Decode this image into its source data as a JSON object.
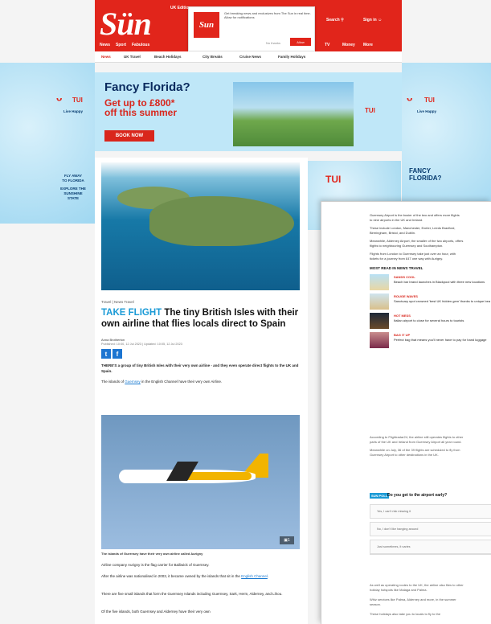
{
  "header": {
    "logo": "Sün",
    "logo_sub": "UK Edition",
    "search": "Search",
    "sign_in": "Sign in",
    "nav": [
      "News",
      "Sport",
      "Fabulous",
      "TV",
      "Money",
      "More"
    ],
    "subnav": [
      "News",
      "UK Travel",
      "Beach Holidays",
      "City Breaks",
      "Cruise News",
      "Family Holidays"
    ]
  },
  "notification": {
    "logo": "Sun",
    "message": "Get breaking news and exclusives from The Sun in real time. Allow for notifications",
    "later": "No thanks",
    "allow": "Allow"
  },
  "left_skin": {
    "brand": "TUI",
    "tagline": "Live Happy",
    "cta_lines": [
      "FLY AWAY",
      "TO FLORIDA",
      "EXPLORE THE",
      "SUNSHINE",
      "STATE"
    ]
  },
  "right_skin": {
    "brand": "TUI",
    "tagline": "Live Happy"
  },
  "banner": {
    "headline": "Fancy Florida?",
    "offer_line1": "Get up to £800*",
    "offer_line2": "off this summer",
    "button": "BOOK NOW",
    "brand": "TUI"
  },
  "ad_right": {
    "brand": "TUI",
    "headline_line1": "FANCY",
    "headline_line2": "FLORIDA?"
  },
  "article": {
    "breadcrumb": "Travel | News Travel",
    "kicker": "TAKE FLIGHT",
    "headline": "The tiny British Isles with their own airline that flies locals direct to Spain",
    "author": "Anna Brotherton",
    "published": "Published: 10:00, 12 Jul 2023 | Updated: 10:05, 12 Jul 2023",
    "share_twitter": "t",
    "share_facebook": "f",
    "intro": "THERE'S a group of tiny British Isles with their very own airline - and they even operate direct flights to the UK and Spain.",
    "p1_a": "The islands of ",
    "p1_link": "Guernsey",
    "p1_b": " in the English Channel have their very own Airline.",
    "photo_caption": "The islands of Guernsey have their very own airline called Aurigny",
    "photo_icon": "1",
    "p2": "Airline company Aurigny is the flag carrier for Bailiwick of Guernsey.",
    "p3_a": "After the airline was nationalised in 2003, it became owned by the islands that sit in the ",
    "p3_link": "English Channel",
    "p3_b": ".",
    "p4": "There are five small islands that form the Guernsey Islands including Guernsey, Sark, Herm, Alderney, and Lihou.",
    "p5": "Of the five islands, both Guernsey and Alderney have their very own"
  },
  "side_panel": {
    "lines": [
      "Guernsey Airport is the busier of the two and offers more flights",
      "to nine airports in the UK and Ireland.",
      "These include London, Manchester, Exeter, Leeds Bradford,",
      "Birmingham, Bristol, and Dublin.",
      "Meanwhile, Alderney Airport, the smaller of the two airports, offers",
      "flights to neighbouring Guernsey and Southampton.",
      "Flights from London to Guernsey take just over an hour, with",
      "tickets for a journey from £47 one way with Aurigny."
    ],
    "most_read_title": "MOST READ IN NEWS TRAVEL",
    "most_read": [
      {
        "kicker": "SANDS COOL",
        "text": "Beach bar brand launches in Blackpool with three new locations"
      },
      {
        "kicker": "ROUGE WAVES",
        "text": "Sanctuary spot crowned 'best UK hidden gem' thanks to unique beach"
      },
      {
        "kicker": "HOT MESS",
        "text": "Italian airport to close for several hours to tourists"
      },
      {
        "kicker": "BAG IT UP",
        "text": "Perfect bag that means you'll never have to pay for hand luggage"
      }
    ],
    "p_after_1": "According to Flightradar24, the airline still operates flights to other",
    "p_after_2": "parts of the UK and Ireland from Guernsey Airport all year round.",
    "p_after_3": "Meanwhile on July, 36 of the 39 flights are scheduled to fly from",
    "p_after_4": "Guernsey Airport to other destinations in the UK.",
    "poll_tag": "SUN POLL",
    "poll_question": "Do you get to the airport early?",
    "poll_options": [
      "Yes, I can't risk missing it",
      "No, I don't like hanging around",
      "Just sometimes, it varies"
    ],
    "bottom_1": "As well as operating routes to the UK, the airline also flies to other",
    "bottom_2": "holiday hotspots like Malaga and Palma.",
    "bottom_3": "Whiz services like Palma, Alderney and more, in the summer",
    "bottom_4": "season.",
    "bottom_5": "These holidays also take you to locals to fly to the"
  },
  "colors": {
    "brand_red": "#e1251b",
    "link_blue": "#1a7ad0",
    "kicker_blue": "#1a9ad6",
    "tui_navy": "#0a2a5e"
  }
}
